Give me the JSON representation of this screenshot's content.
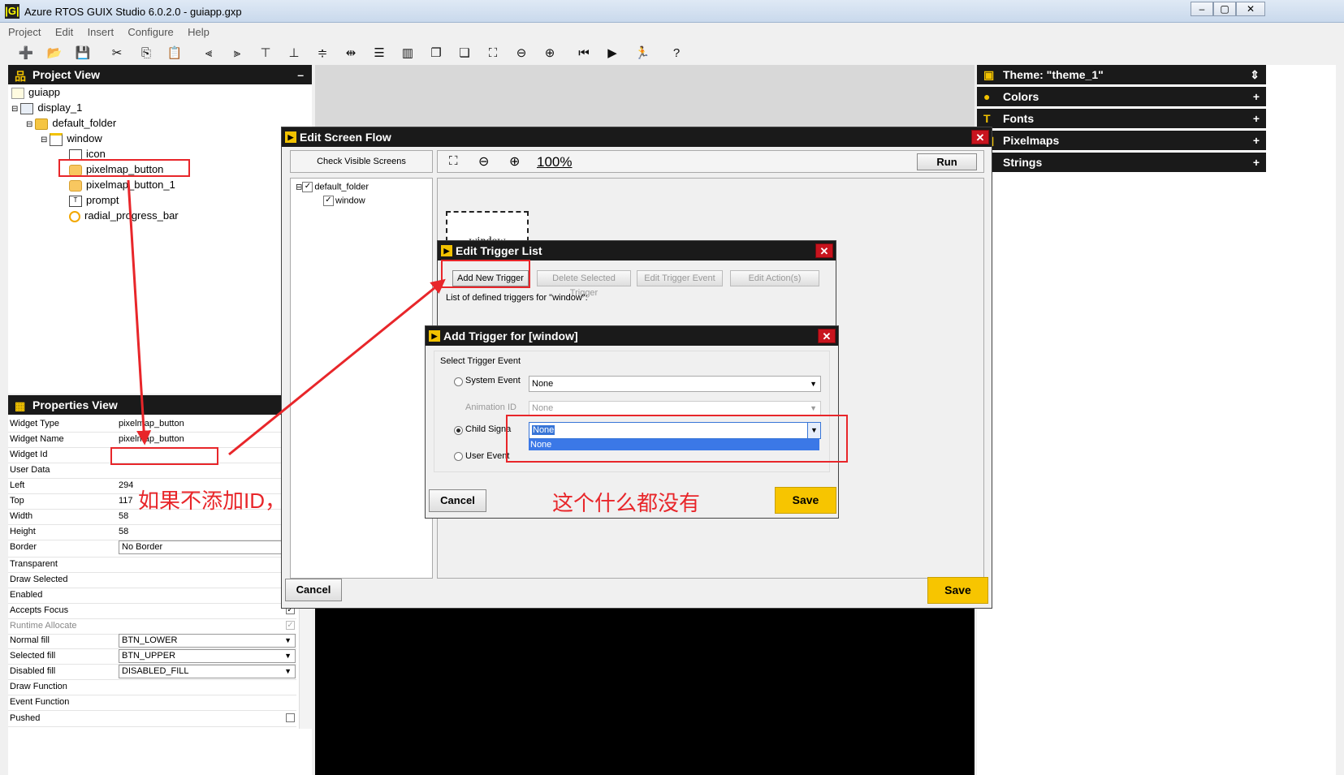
{
  "app": {
    "title": "Azure RTOS GUIX Studio 6.0.2.0 - guiapp.gxp",
    "icon_label": "|G|",
    "window_controls": [
      "minimize-icon",
      "maximize-icon",
      "close-icon"
    ]
  },
  "menu": [
    "Project",
    "Edit",
    "Insert",
    "Configure",
    "Help"
  ],
  "toolbar": [
    "new-icon",
    "open-icon",
    "save-icon",
    "cut-icon",
    "copy-icon",
    "paste-icon",
    "align-left-icon",
    "align-right-icon",
    "align-top-icon",
    "align-bottom-icon",
    "vertical-center-icon",
    "horizontal-space-icon",
    "equal-height-icon",
    "equal-width-icon",
    "move-to-front-icon",
    "move-to-back-icon",
    "size-to-fit-icon",
    "zoom-out-icon",
    "zoom-in-icon",
    "record-icon",
    "run-icon",
    "run-app-icon",
    "help-icon"
  ],
  "project_view": {
    "title": "Project View",
    "collapse": "–",
    "tree": [
      {
        "label": "guiapp",
        "icon": "project-icon"
      },
      {
        "label": "display_1",
        "icon": "display-icon"
      },
      {
        "label": "default_folder",
        "icon": "folder-icon"
      },
      {
        "label": "window",
        "icon": "window-icon"
      },
      {
        "label": "icon",
        "icon": "image-icon"
      },
      {
        "label": "pixelmap_button",
        "icon": "button-icon"
      },
      {
        "label": "pixelmap_button_1",
        "icon": "button-icon"
      },
      {
        "label": "prompt",
        "icon": "text-icon"
      },
      {
        "label": "radial_progress_bar",
        "icon": "progress-icon"
      }
    ]
  },
  "properties_view": {
    "title": "Properties View",
    "rows": [
      {
        "key": "Widget Type",
        "value": "pixelmap_button"
      },
      {
        "key": "Widget Name",
        "value": "pixelmap_button"
      },
      {
        "key": "Widget Id",
        "value": ""
      },
      {
        "key": "User Data",
        "value": ""
      },
      {
        "key": "Left",
        "value": "294"
      },
      {
        "key": "Top",
        "value": "117"
      },
      {
        "key": "Width",
        "value": "58"
      },
      {
        "key": "Height",
        "value": "58"
      },
      {
        "key": "Border",
        "value": "No Border"
      },
      {
        "key": "Transparent",
        "value": ""
      },
      {
        "key": "Draw Selected",
        "value": ""
      },
      {
        "key": "Enabled",
        "value": ""
      },
      {
        "key": "Accepts Focus",
        "value": ""
      },
      {
        "key": "Runtime Allocate",
        "value": ""
      },
      {
        "key": "Normal fill",
        "value": "BTN_LOWER"
      },
      {
        "key": "Selected fill",
        "value": "BTN_UPPER"
      },
      {
        "key": "Disabled fill",
        "value": "DISABLED_FILL"
      },
      {
        "key": "Draw Function",
        "value": ""
      },
      {
        "key": "Event Function",
        "value": ""
      },
      {
        "key": "Pushed",
        "value": ""
      }
    ]
  },
  "right_panel": {
    "theme": "Theme: \"theme_1\"",
    "sections": [
      "Colors",
      "Fonts",
      "Pixelmaps",
      "Strings"
    ],
    "plus": "+"
  },
  "screen_flow": {
    "title": "Edit Screen Flow",
    "check_visible": "Check Visible Screens",
    "tree": [
      "default_folder",
      "window"
    ],
    "zoom": "100%",
    "run": "Run",
    "canvas_window": "window",
    "cancel": "Cancel",
    "save": "Save"
  },
  "trigger_list": {
    "title": "Edit Trigger List",
    "add": "Add New Trigger",
    "delete": "Delete Selected Trigger",
    "edit_event": "Edit Trigger Event",
    "edit_actions": "Edit Action(s)",
    "list_label": "List of defined triggers for \"window\":"
  },
  "add_trigger": {
    "title": "Add Trigger for [window]",
    "group": "Select Trigger Event",
    "system_event": "System Event",
    "system_value": "None",
    "animation_id": "Animation ID",
    "animation_value": "None",
    "child_signal": "Child Signa",
    "child_value": "None",
    "dropdown_option": "None",
    "user_event": "User Event",
    "cancel": "Cancel",
    "save": "Save"
  },
  "annotations": {
    "left_note": "如果不添加ID，",
    "right_note": "这个什么都没有",
    "color": "#e8262a"
  }
}
